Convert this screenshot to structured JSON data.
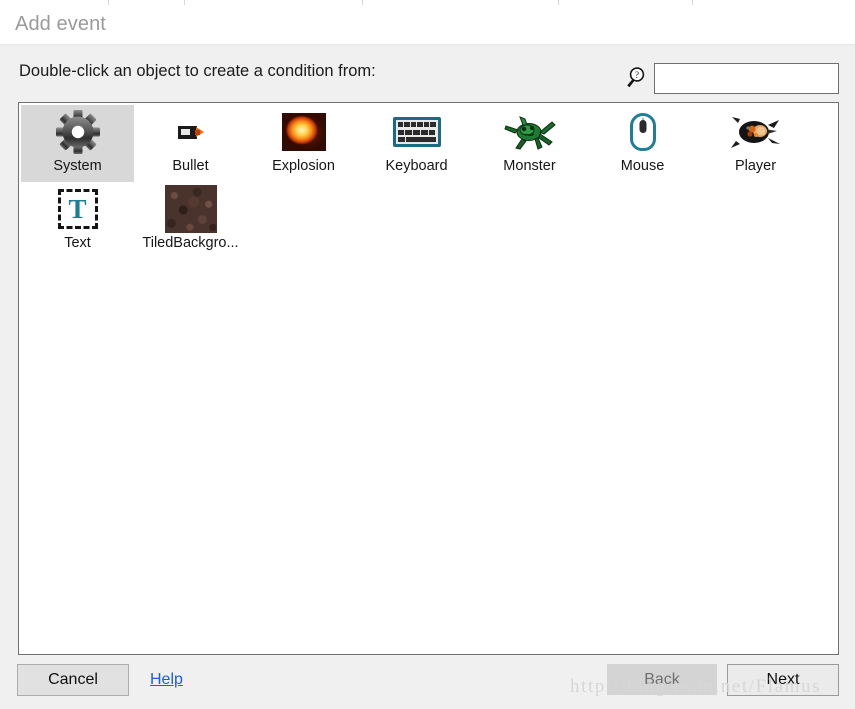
{
  "window": {
    "title": "Add event"
  },
  "instruction": "Double-click an object to create a condition from:",
  "search": {
    "icon": "magnifier-icon",
    "value": "",
    "placeholder": ""
  },
  "objects": [
    {
      "label": "System",
      "icon": "gear-icon",
      "selected": true
    },
    {
      "label": "Bullet",
      "icon": "bullet-icon",
      "selected": false
    },
    {
      "label": "Explosion",
      "icon": "explosion-icon",
      "selected": false
    },
    {
      "label": "Keyboard",
      "icon": "keyboard-icon",
      "selected": false
    },
    {
      "label": "Monster",
      "icon": "monster-icon",
      "selected": false
    },
    {
      "label": "Mouse",
      "icon": "mouse-icon",
      "selected": false
    },
    {
      "label": "Player",
      "icon": "player-icon",
      "selected": false
    },
    {
      "label": "Text",
      "icon": "text-icon",
      "selected": false
    },
    {
      "label": "TiledBackgro...",
      "icon": "tiled-background-icon",
      "selected": false
    }
  ],
  "footer": {
    "cancel": "Cancel",
    "help": "Help",
    "back": "Back",
    "next": "Next",
    "back_disabled": true
  },
  "watermark": "http://blog.csdn.net/Flamus",
  "colors": {
    "dialog_bg": "#f0f0f0",
    "panel_bg": "#ffffff",
    "title_text": "#9a9a9a",
    "selection": "#d8d8d8",
    "link": "#1a5fd4",
    "accent_teal": "#1f7f99",
    "disabled_text": "#6f6f6f"
  }
}
